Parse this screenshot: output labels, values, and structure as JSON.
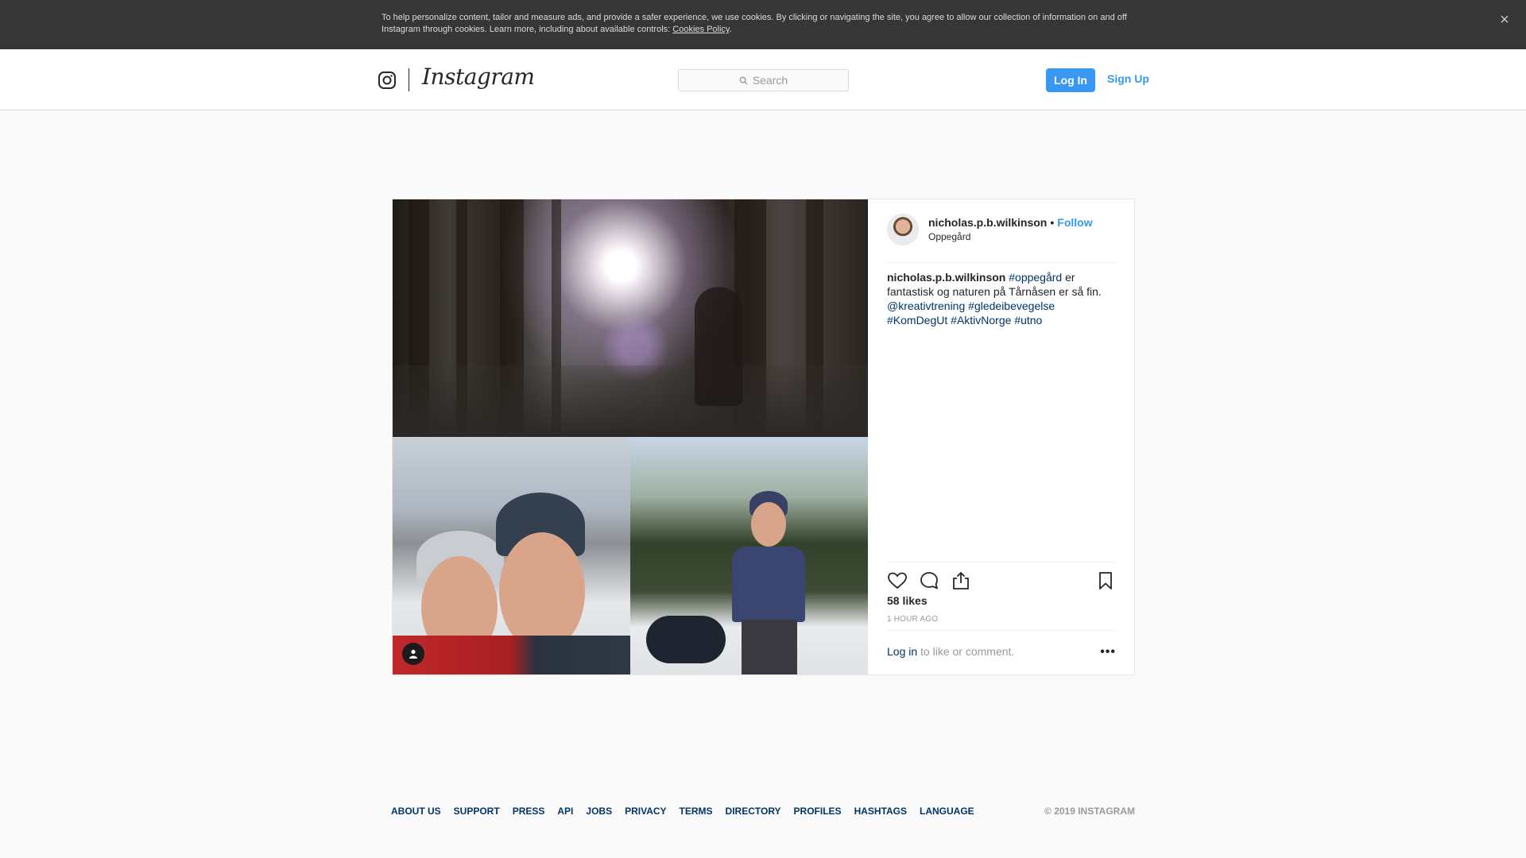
{
  "cookie_banner": {
    "text": "To help personalize content, tailor and measure ads, and provide a safer experience, we use cookies. By clicking or navigating the site, you agree to allow our collection of information on and off Instagram through cookies. Learn more, including about available controls:",
    "link": "Cookies Policy",
    "period": ".",
    "close": "×"
  },
  "header": {
    "wordmark": "Instagram",
    "search_placeholder": "Search",
    "login": "Log In",
    "signup": "Sign Up"
  },
  "post": {
    "username": "nicholas.p.b.wilkinson",
    "separator": "•",
    "follow": "Follow",
    "location": "Oppegård",
    "caption": {
      "user": "nicholas.p.b.wilkinson",
      "tag1": "#oppegård",
      "text": "er fantastisk og naturen på Tårnåsen er så fin.",
      "mention": "@kreativtrening",
      "tag2": "#gledeibevegelse",
      "tag3": "#KomDegUt",
      "tag4": "#AktivNorge",
      "tag5": "#utno"
    },
    "likes": "58 likes",
    "time_ago": "1 HOUR AGO",
    "comment_login": "Log in",
    "comment_rest": "to like or comment.",
    "more": "•••"
  },
  "icons": {
    "close": "close-icon",
    "logo": "instagram-glyph-icon",
    "search": "search-icon",
    "like": "heart-icon",
    "comment": "comment-icon",
    "share": "share-icon",
    "save": "bookmark-icon",
    "tagged": "user-tag-icon"
  },
  "footer": {
    "links": [
      "ABOUT US",
      "SUPPORT",
      "PRESS",
      "API",
      "JOBS",
      "PRIVACY",
      "TERMS",
      "DIRECTORY",
      "PROFILES",
      "HASHTAGS",
      "LANGUAGE"
    ],
    "copyright": "© 2019 INSTAGRAM"
  },
  "colors": {
    "accent": "#3897f0",
    "link_dark": "#003569",
    "banner_bg": "#363636"
  }
}
